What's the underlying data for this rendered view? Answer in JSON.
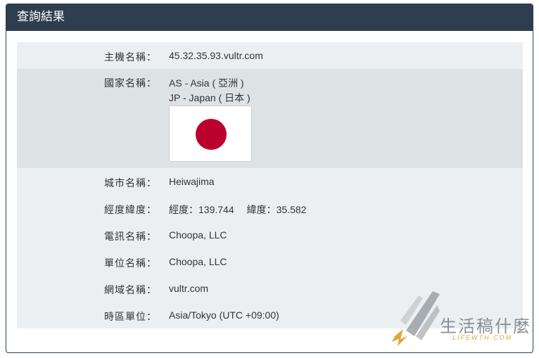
{
  "panel": {
    "title": "查詢結果"
  },
  "rows": {
    "host": {
      "label": "主機名稱：",
      "value": "45.32.35.93.vultr.com"
    },
    "country": {
      "label": "國家名稱：",
      "line1": "AS - Asia ( 亞洲 )",
      "line2": "JP - Japan ( 日本 )",
      "flag_icon": "japan-flag-icon"
    },
    "city": {
      "label": "城市名稱：",
      "value": "Heiwajima"
    },
    "coords": {
      "label": "經度緯度：",
      "longitude": "經度：139.744",
      "latitude": "緯度：35.582"
    },
    "isp": {
      "label": "電訊名稱：",
      "value": "Choopa, LLC"
    },
    "org": {
      "label": "單位名稱：",
      "value": "Choopa, LLC"
    },
    "domain": {
      "label": "網域名稱：",
      "value": "vultr.com"
    },
    "timezone": {
      "label": "時區單位：",
      "value": "Asia/Tokyo (UTC +09:00)"
    }
  },
  "watermark": {
    "title": "生活稿什麼",
    "subtitle": "LIFEWTH.COM"
  },
  "colors": {
    "header_bg": "#2e3e4f",
    "row_light": "#eceff1",
    "row_dark": "#dde2e5",
    "flag_red": "#bc002d"
  }
}
